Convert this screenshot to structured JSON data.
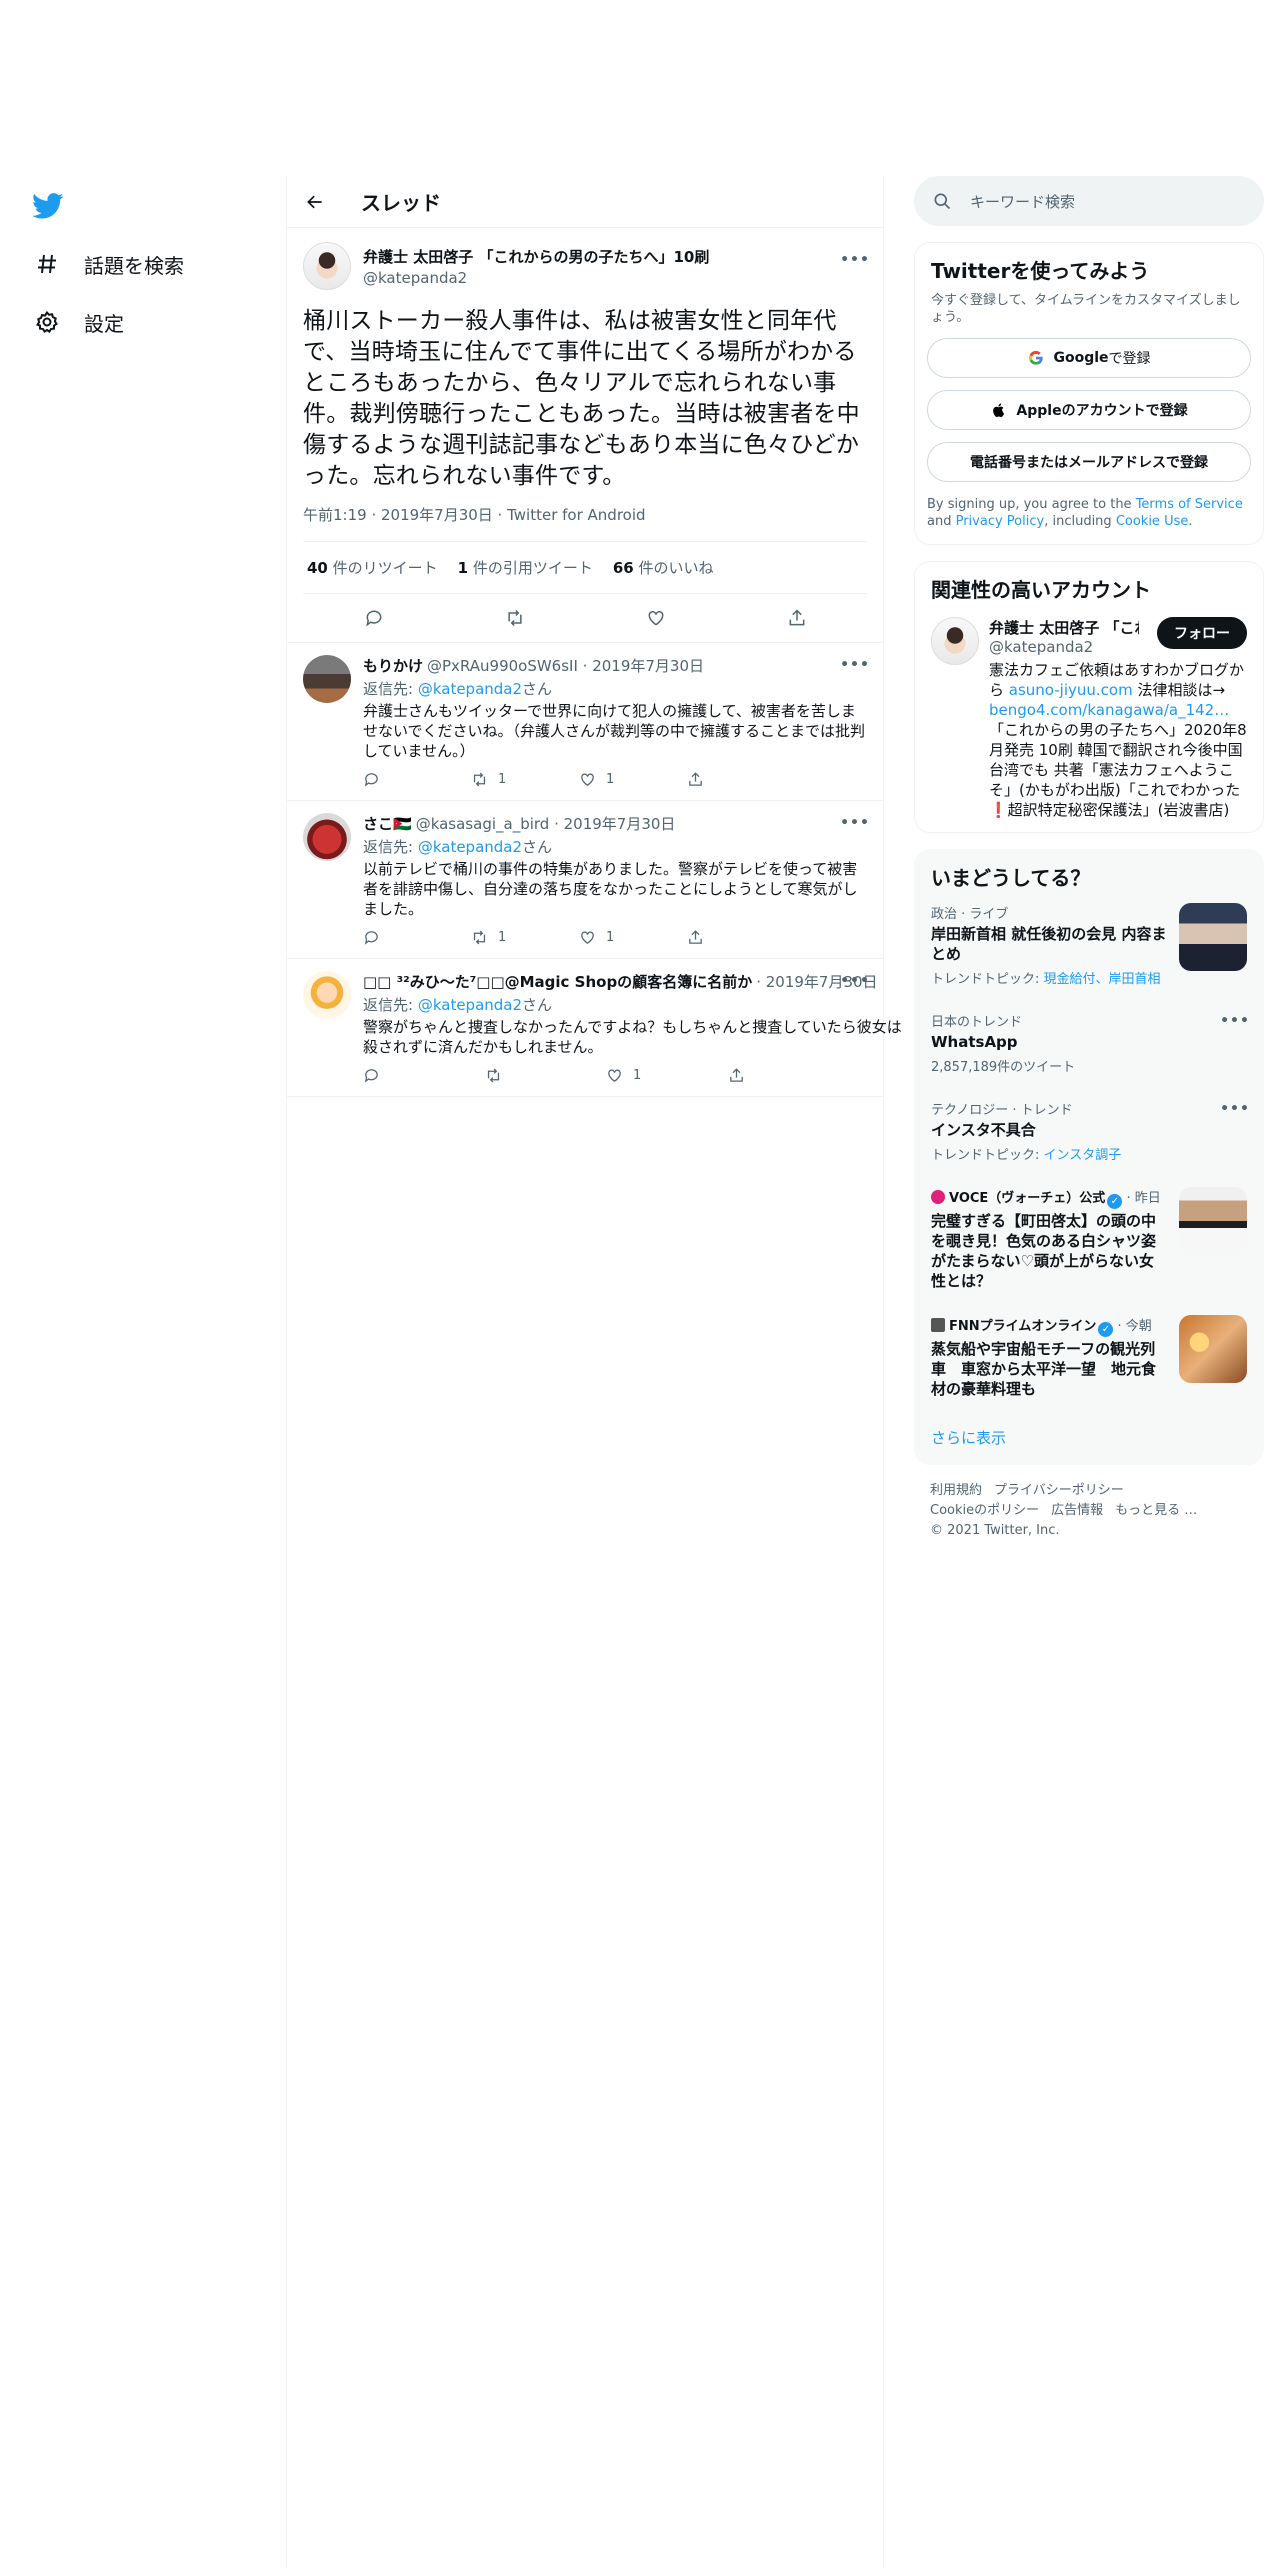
{
  "nav": {
    "explore_label": "話題を検索",
    "settings_label": "設定"
  },
  "thread": {
    "title": "スレッド",
    "main": {
      "name": "弁護士 太田啓子 「これからの男の子たちへ」10刷",
      "handle": "@katepanda2",
      "text": "桶川ストーカー殺人事件は、私は被害女性と同年代で、当時埼玉に住んでて事件に出てくる場所がわかるところもあったから、色々リアルで忘れられない事件。裁判傍聴行ったこともあった。当時は被害者を中傷するような週刊誌記事などもあり本当に色々ひどかった。忘れられない事件です。",
      "meta": "午前1:19 · 2019年7月30日 · Twitter for Android",
      "stats": {
        "retweets_count": "40",
        "retweets_label": " 件のリツイート",
        "quotes_count": "1",
        "quotes_label": " 件の引用ツイート",
        "likes_count": "66",
        "likes_label": " 件のいいね"
      }
    },
    "replies": [
      {
        "name": "もりかけ",
        "handle": "@PxRAu990oSW6sII · 2019年7月30日",
        "to_label": "返信先: ",
        "to_handle": "@katepanda2",
        "to_suffix": "さん",
        "text": "弁護士さんもツイッターで世界に向けて犯人の擁護して、被害者を苦しませないでくださいね。（弁護人さんが裁判等の中で擁護することまでは批判していません。）",
        "retweets": "1",
        "likes": "1"
      },
      {
        "name": "さこ🇯🇴",
        "handle": "@kasasagi_a_bird · 2019年7月30日",
        "to_label": "返信先: ",
        "to_handle": "@katepanda2",
        "to_suffix": "さん",
        "text": "以前テレビで桶川の事件の特集がありました。警察がテレビを使って被害者を誹謗中傷し、自分達の落ち度をなかったことにしようとして寒気がしました。",
        "retweets": "1",
        "likes": "1"
      },
      {
        "name": "□□ ³²みひ〜た⁷□□@Magic Shopの顧客名簿に名前か",
        "handle": " · 2019年7月30日",
        "to_label": "返信先: ",
        "to_handle": "@katepanda2",
        "to_suffix": "さん",
        "text": "警察がちゃんと捜査しなかったんですよね？もしちゃんと捜査していたら彼女は殺されずに済んだかもしれません。",
        "retweets": "",
        "likes": "1"
      }
    ]
  },
  "search": {
    "placeholder": "キーワード検索"
  },
  "signup": {
    "title": "Twitterを使ってみよう",
    "subtitle": "今すぐ登録して、タイムラインをカスタマイズしましょう。",
    "google_label": "Google",
    "google_suffix": " で登録",
    "apple_label": "Appleのアカウントで登録",
    "phone_label": "電話番号またはメールアドレスで登録",
    "terms_prefix": "By signing up, you agree to the ",
    "terms_link": "Terms of Service",
    "terms_and": " and ",
    "privacy_link": "Privacy Policy",
    "terms_including": ", including ",
    "cookie_link": "Cookie Use",
    "terms_end": "."
  },
  "related": {
    "title": "関連性の高いアカウント",
    "name": "弁護士 太田啓子 「これからの男の子たちへ」",
    "handle": "@katepanda2",
    "follow_label": "フォロー",
    "bio_1": "憲法カフェご依頼はあすわかブログから ",
    "bio_link_1": "asuno-jiyuu.com",
    "bio_2": " 法律相談は→ ",
    "bio_link_2": "bengo4.com/kanagawa/a_142…",
    "bio_3": " 「これからの男の子たちへ」2020年8月発売 10刷 韓国で翻訳され今後中国台湾でも 共著「憲法カフェへようこそ」(かもがわ出版)「これでわかった❗️超訳特定秘密保護法」(岩波書店)"
  },
  "trends": {
    "title": "いまどうしてる？",
    "items": [
      {
        "category": "政治 · ライブ",
        "title": "岸田新首相 就任後初の会見 内容まとめ",
        "sub_label": "トレンドトピック: ",
        "sub_links": "現金給付、岸田首相"
      },
      {
        "category": "日本のトレンド",
        "title": "WhatsApp",
        "sub": "2,857,189件のツイート"
      },
      {
        "category": "テクノロジー · トレンド",
        "title": "インスタ不具合",
        "sub_label": "トレンドトピック: ",
        "sub_links": "インスタ調子"
      },
      {
        "source": "VOCE（ヴォーチェ）公式",
        "time": " · 昨日",
        "title": "完璧すぎる【町田啓太】の頭の中を覗き見！色気のある白シャツ姿がたまらない♡頭が上がらない女性とは？"
      },
      {
        "source": "FNNプライムオンライン",
        "time": " · 今朝",
        "title": "蒸気船や宇宙船モチーフの観光列車　車窓から太平洋一望　地元食材の豪華料理も"
      }
    ],
    "show_more": "さらに表示"
  },
  "footer": {
    "terms": "利用規約",
    "privacy": "プライバシーポリシー",
    "cookie": "Cookieのポリシー",
    "ads": "広告情報",
    "more": "もっと見る …",
    "copyright": "© 2021 Twitter, Inc."
  },
  "colors": {
    "brand": "#1d9bf0",
    "text": "#0f1419",
    "muted": "#536471",
    "border": "#eff3f4"
  }
}
